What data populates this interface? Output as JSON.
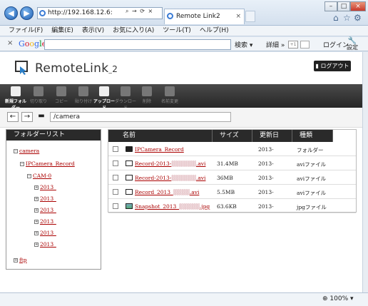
{
  "browser": {
    "url": "http://192.168.12.6:",
    "tab_title": "Remote Link2",
    "address_icons": "⌕ → ⟳ ×",
    "menu": [
      "ファイル(F)",
      "編集(E)",
      "表示(V)",
      "お気に入り(A)",
      "ツール(T)",
      "ヘルプ(H)"
    ],
    "window_buttons": [
      "–",
      "□",
      "×"
    ],
    "top_right_icons": [
      "home-icon",
      "favorites-icon",
      "tools-icon"
    ],
    "zoom": "⊕ 100% ▾"
  },
  "google_bar": {
    "close": "×",
    "logo": "Google",
    "search_label": "検索 ▾",
    "details_label": "詳細 »",
    "login_label": "ログイン",
    "settings_label": "設定"
  },
  "app": {
    "logo_main": "RemoteLink",
    "logo_suffix": "2",
    "logout_label": "ログアウト",
    "toolbar": [
      {
        "label": "新規フォルダー",
        "active": true
      },
      {
        "label": "切り取り",
        "active": false
      },
      {
        "label": "コピー",
        "active": false
      },
      {
        "label": "貼り付け",
        "active": false
      },
      {
        "label": "アップロード",
        "active": true
      },
      {
        "label": "ダウンロード",
        "active": false
      },
      {
        "label": "削除",
        "active": false
      },
      {
        "label": "名前変更",
        "active": false
      }
    ],
    "path": "/camera",
    "folder_list_title": "フォルダーリスト",
    "tree": [
      {
        "label": "camera",
        "sign": "−"
      },
      {
        "label": "IPCamera_Record",
        "sign": "−"
      },
      {
        "label": "CAM-0",
        "sign": "−"
      },
      {
        "label": "2013_",
        "sign": "+"
      },
      {
        "label": "2013_",
        "sign": "+"
      },
      {
        "label": "2013_",
        "sign": "+"
      },
      {
        "label": "2013_",
        "sign": "+"
      },
      {
        "label": "2013_",
        "sign": "+"
      },
      {
        "label": "2013_",
        "sign": "+"
      },
      {
        "label": "ftp",
        "sign": "+"
      }
    ],
    "columns": [
      "名前",
      "サイズ",
      "更新日",
      "種類"
    ],
    "files": [
      {
        "name": "IPCamera_Record",
        "size": "",
        "date": "2013-",
        "type": "フォルダー",
        "icon": "folder-icon"
      },
      {
        "name": "Record-2013-",
        "name_end": ".avi",
        "size": "31.4MB",
        "date": "2013-",
        "type": "aviファイル",
        "icon": "video-icon"
      },
      {
        "name": "Record-2013-",
        "name_end": ".avi",
        "size": "36MB",
        "date": "2013-",
        "type": "aviファイル",
        "icon": "video-icon"
      },
      {
        "name": "Record_2013_",
        "name_end": ".avi",
        "size": "5.5MB",
        "date": "2013-",
        "type": "aviファイル",
        "icon": "video-icon"
      },
      {
        "name": "Snapshot_2013_",
        "name_end": ".jpg",
        "size": "63.6KB",
        "date": "2013-",
        "type": "jpgファイル",
        "icon": "image-icon"
      }
    ]
  }
}
